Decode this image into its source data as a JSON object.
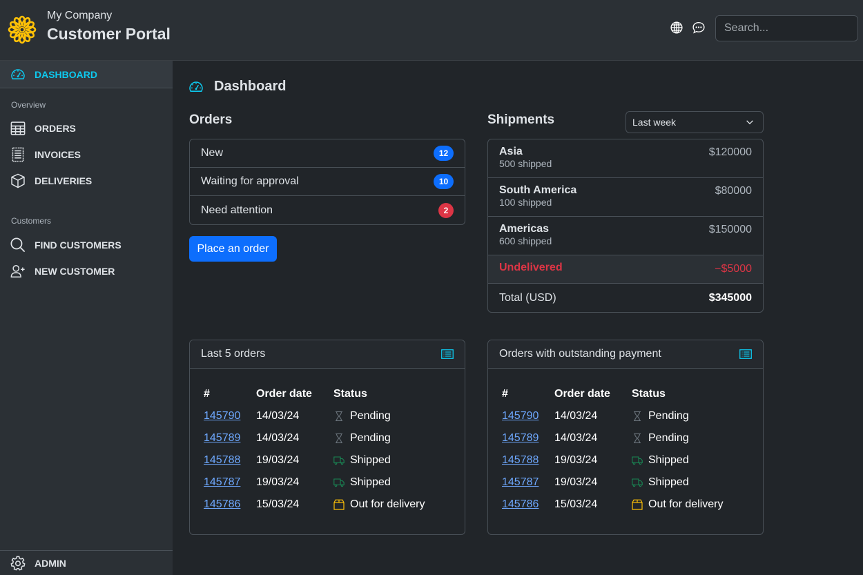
{
  "header": {
    "company": "My Company",
    "title": "Customer Portal",
    "search_placeholder": "Search...",
    "icons": [
      "globe-icon",
      "chat-icon"
    ]
  },
  "colors": {
    "accent": "#0dcaf0",
    "primary": "#0d6efd",
    "danger": "#dc3545",
    "success": "#198754",
    "warning": "#ffc107",
    "logo": "#ffc107"
  },
  "sidebar": {
    "active": {
      "label": "DASHBOARD",
      "icon": "speedometer-icon"
    },
    "sections": [
      {
        "heading": "Overview",
        "items": [
          {
            "label": "ORDERS",
            "icon": "table-icon"
          },
          {
            "label": "INVOICES",
            "icon": "receipt-icon"
          },
          {
            "label": "DELIVERIES",
            "icon": "box-icon"
          }
        ]
      },
      {
        "heading": "Customers",
        "items": [
          {
            "label": "FIND CUSTOMERS",
            "icon": "search-icon"
          },
          {
            "label": "NEW CUSTOMER",
            "icon": "person-add-icon"
          }
        ]
      }
    ],
    "bottom": {
      "label": "ADMIN",
      "icon": "gear-icon"
    }
  },
  "main": {
    "page_title": "Dashboard",
    "orders": {
      "title": "Orders",
      "items": [
        {
          "label": "New",
          "count": "12",
          "variant": "primary"
        },
        {
          "label": "Waiting for approval",
          "count": "10",
          "variant": "primary"
        },
        {
          "label": "Need attention",
          "count": "2",
          "variant": "danger"
        }
      ],
      "button_label": "Place an order"
    },
    "shipments": {
      "title": "Shipments",
      "period": "Last week",
      "rows": [
        {
          "region": "Asia",
          "shipped": "500 shipped",
          "amount": "$120000"
        },
        {
          "region": "South America",
          "shipped": "100 shipped",
          "amount": "$80000"
        },
        {
          "region": "Americas",
          "shipped": "600 shipped",
          "amount": "$150000"
        }
      ],
      "undelivered": {
        "label": "Undelivered",
        "amount": "−$5000"
      },
      "total": {
        "label": "Total (USD)",
        "amount": "$345000"
      }
    },
    "tables": [
      {
        "title": "Last 5 orders",
        "columns": [
          "#",
          "Order date",
          "Status"
        ],
        "rows": [
          {
            "id": "145790",
            "date": "14/03/24",
            "status": "Pending"
          },
          {
            "id": "145789",
            "date": "14/03/24",
            "status": "Pending"
          },
          {
            "id": "145788",
            "date": "19/03/24",
            "status": "Shipped"
          },
          {
            "id": "145787",
            "date": "19/03/24",
            "status": "Shipped"
          },
          {
            "id": "145786",
            "date": "15/03/24",
            "status": "Out for delivery"
          }
        ]
      },
      {
        "title": "Orders with outstanding payment",
        "columns": [
          "#",
          "Order date",
          "Status"
        ],
        "rows": [
          {
            "id": "145790",
            "date": "14/03/24",
            "status": "Pending"
          },
          {
            "id": "145789",
            "date": "14/03/24",
            "status": "Pending"
          },
          {
            "id": "145788",
            "date": "19/03/24",
            "status": "Shipped"
          },
          {
            "id": "145787",
            "date": "19/03/24",
            "status": "Shipped"
          },
          {
            "id": "145786",
            "date": "15/03/24",
            "status": "Out for delivery"
          }
        ]
      }
    ]
  }
}
